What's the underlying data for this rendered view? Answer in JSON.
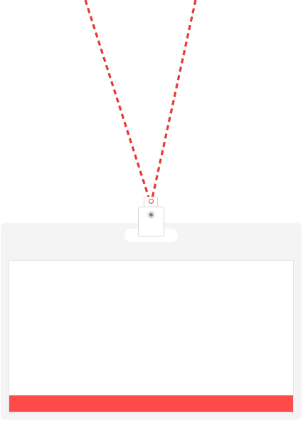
{
  "colors": {
    "lanyard_red": "#e53935",
    "lanyard_white": "#ffffff",
    "holder": "#f4f4f4",
    "card": "#ffffff",
    "stripe": "#ff4a4a",
    "rivet": "#7a7a7a"
  },
  "icons": {
    "clip": "id-badge-clip",
    "rivet": "rivet-icon"
  }
}
